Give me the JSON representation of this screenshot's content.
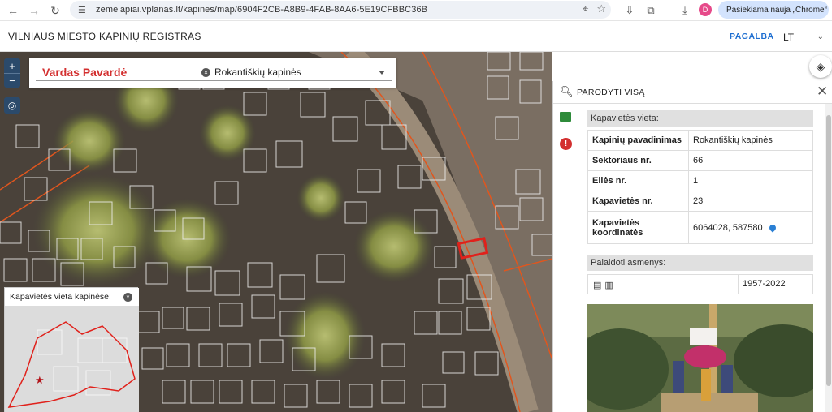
{
  "browser": {
    "url": "zemelapiai.vplanas.lt/kapines/map/6904F2CB-A8B9-4FAB-8AA6-5E19CFBBC36B",
    "avatar_letter": "D",
    "update_label": "Pasiekiama nauja „Chrome“"
  },
  "header": {
    "title": "VILNIAUS MIESTO KAPINIŲ REGISTRAS",
    "help": "PAGALBA",
    "language": "LT"
  },
  "search": {
    "name_value": "Vardas Pavardė",
    "cemetery_value": "Rokantiškių kapinės"
  },
  "map_controls": {
    "zoom_in": "+",
    "zoom_out": "−"
  },
  "minimap": {
    "title": "Kapavietės vieta kapinėse:"
  },
  "panel": {
    "show_all": "PARODYTI VISĄ",
    "grave_section": "Kapavietės vieta:",
    "rows": [
      {
        "key": "Kapinių pavadinimas",
        "value": "Rokantiškių kapinės"
      },
      {
        "key": "Sektoriaus nr.",
        "value": "66"
      },
      {
        "key": "Eilės nr.",
        "value": "1"
      },
      {
        "key": "Kapavietės nr.",
        "value": "23"
      },
      {
        "key": "Kapavietės koordinatės",
        "value": "6064028, 587580"
      }
    ],
    "buried_section": "Palaidoti asmenys:",
    "buried_dates": "1957-2022"
  },
  "colors": {
    "accent": "#1f6fd1",
    "name_red": "#d32f2f",
    "highlight": "#e0211b"
  }
}
